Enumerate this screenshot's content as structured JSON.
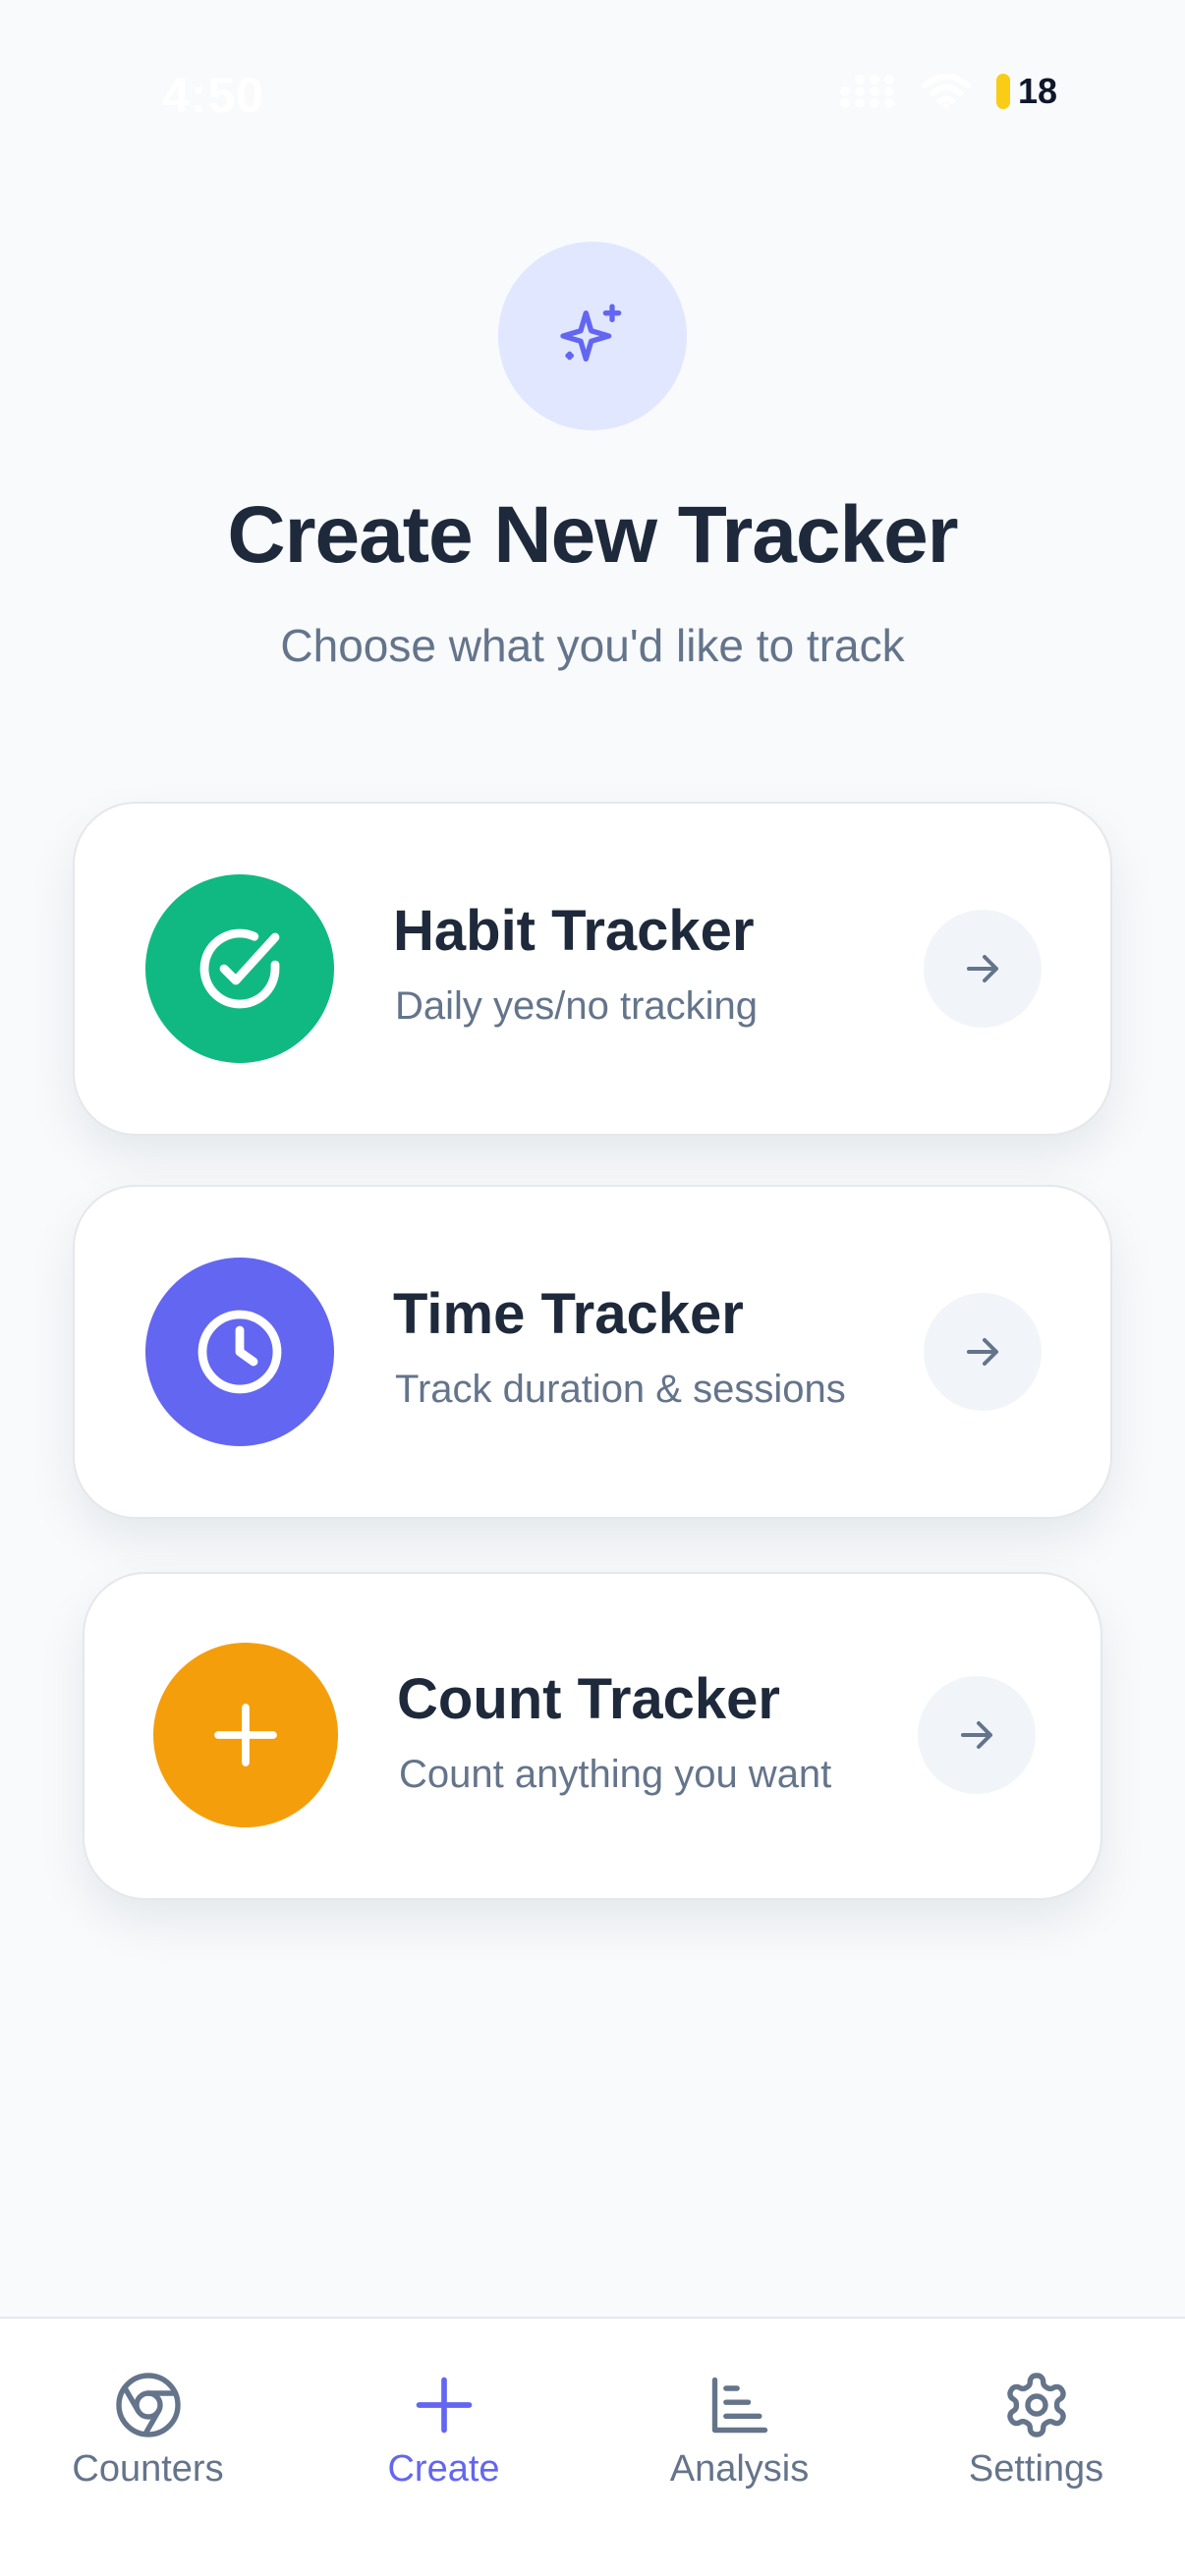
{
  "status_bar": {
    "time": "4:50",
    "battery": "18"
  },
  "header": {
    "title": "Create New Tracker",
    "subtitle": "Choose what you'd like to track"
  },
  "cards": [
    {
      "title": "Habit Tracker",
      "description": "Daily yes/no tracking",
      "icon": "check-circle-icon",
      "color": "#10b981"
    },
    {
      "title": "Time Tracker",
      "description": "Track duration & sessions",
      "icon": "clock-icon",
      "color": "#6366f1"
    },
    {
      "title": "Count Tracker",
      "description": "Count anything you want",
      "icon": "plus-icon",
      "color": "#f59e0b"
    }
  ],
  "tab_bar": {
    "tabs": [
      {
        "label": "Counters",
        "icon": "aperture-icon",
        "active": false
      },
      {
        "label": "Create",
        "icon": "plus-icon",
        "active": true
      },
      {
        "label": "Analysis",
        "icon": "bar-chart-icon",
        "active": false
      },
      {
        "label": "Settings",
        "icon": "gear-icon",
        "active": false
      }
    ]
  },
  "colors": {
    "accent": "#6366f1",
    "background": "#f8fafc",
    "text_primary": "#1e293b",
    "text_secondary": "#64748b"
  }
}
